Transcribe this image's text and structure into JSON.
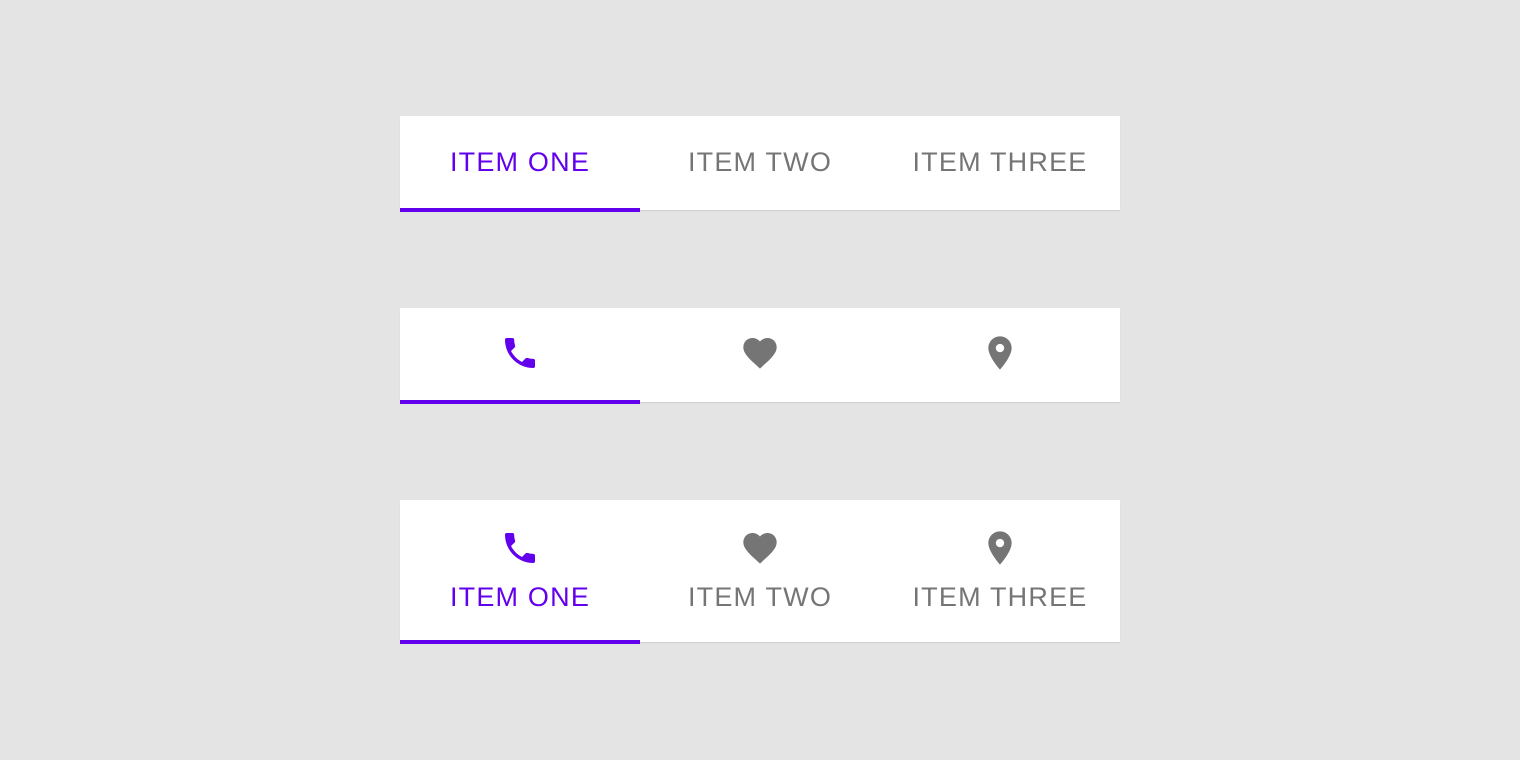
{
  "colors": {
    "background": "#e4e4e4",
    "surface": "#ffffff",
    "active": "#6200ee",
    "inactive": "#757575"
  },
  "text_tabs": {
    "active_index": 0,
    "items": [
      {
        "label": "ITEM ONE"
      },
      {
        "label": "ITEM TWO"
      },
      {
        "label": "ITEM THREE"
      }
    ]
  },
  "icon_tabs": {
    "active_index": 0,
    "items": [
      {
        "icon": "phone-icon"
      },
      {
        "icon": "heart-icon"
      },
      {
        "icon": "location-pin-icon"
      }
    ]
  },
  "icon_text_tabs": {
    "active_index": 0,
    "items": [
      {
        "icon": "phone-icon",
        "label": "ITEM ONE"
      },
      {
        "icon": "heart-icon",
        "label": "ITEM TWO"
      },
      {
        "icon": "location-pin-icon",
        "label": "ITEM THREE"
      }
    ]
  }
}
